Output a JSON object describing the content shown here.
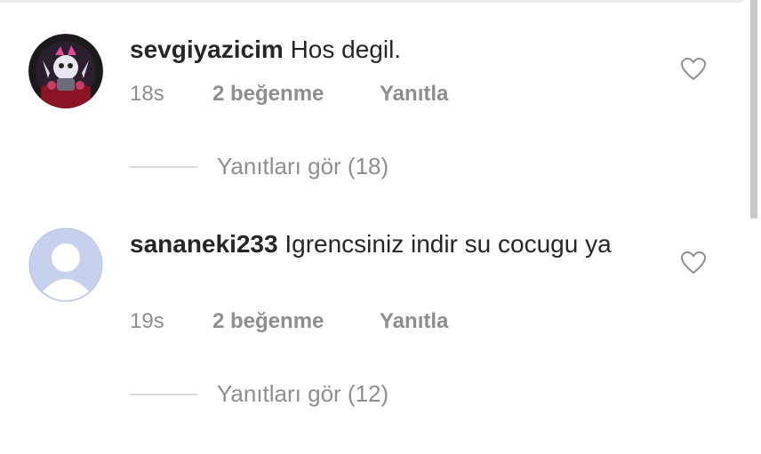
{
  "comments": [
    {
      "username": "sevgiyazicim",
      "text": "Hos degil.",
      "time": "18s",
      "likes": "2 beğenme",
      "reply": "Yanıtla",
      "view_replies": "Yanıtları gör (18)"
    },
    {
      "username": "sananeki233",
      "text": "Igrencsiniz indir su cocugu ya",
      "time": "19s",
      "likes": "2 beğenme",
      "reply": "Yanıtla",
      "view_replies": "Yanıtları gör (12)"
    }
  ],
  "colors": {
    "text": "#262626",
    "secondary": "#8e8e8e",
    "divider": "#dbdbdb",
    "default_avatar_bg": "#c7d1ee"
  },
  "icons": [
    "heart-icon",
    "default-avatar-icon"
  ]
}
